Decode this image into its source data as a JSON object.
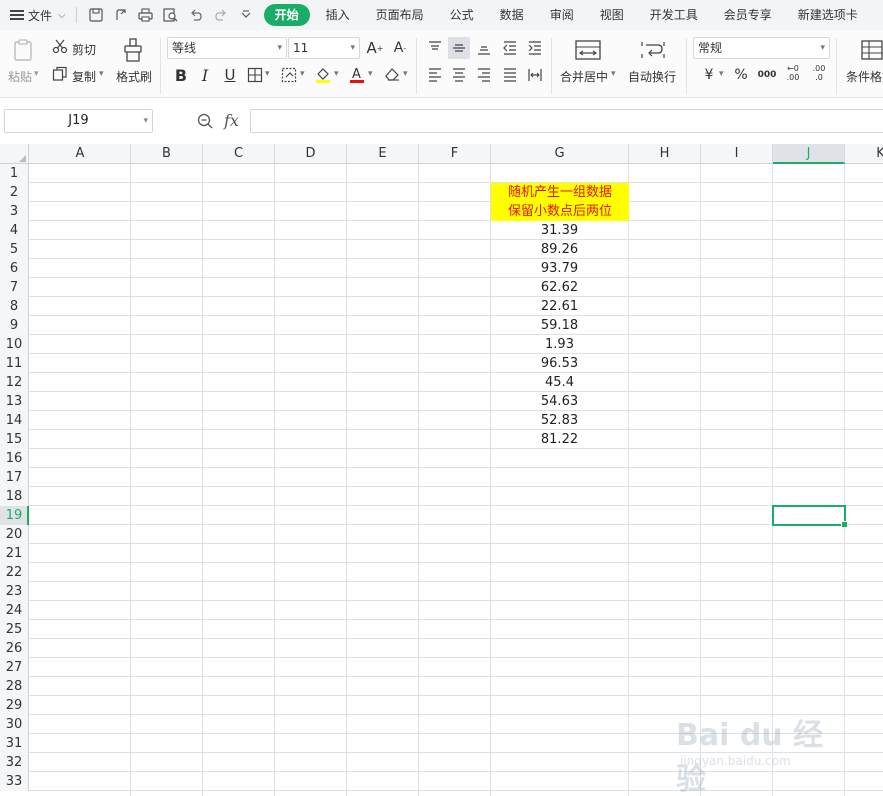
{
  "menubar": {
    "file_label": "文件",
    "tabs": [
      "开始",
      "插入",
      "页面布局",
      "公式",
      "数据",
      "审阅",
      "视图",
      "开发工具",
      "会员专享",
      "新建选项卡"
    ],
    "active_tab": "开始"
  },
  "ribbon": {
    "paste": "粘贴",
    "cut": "剪切",
    "copy": "复制",
    "format_painter": "格式刷",
    "font_name": "等线",
    "font_size": "11",
    "bold": "B",
    "italic": "I",
    "underline": "U",
    "merge_center": "合并居中",
    "wrap_text": "自动换行",
    "number_format": "常规",
    "currency": "¥",
    "percent": "%",
    "thousands": "000",
    "inc_decimal": ".00",
    "dec_decimal": ".0",
    "conditional_format": "条件格式"
  },
  "formula_bar": {
    "name_box": "J19",
    "fx": "fx",
    "value": ""
  },
  "columns": [
    "A",
    "B",
    "C",
    "D",
    "E",
    "F",
    "G",
    "H",
    "I",
    "J",
    "K"
  ],
  "selected_column": "J",
  "selected_row": "19",
  "rows": [
    "1",
    "2",
    "3",
    "4",
    "5",
    "6",
    "7",
    "8",
    "9",
    "10",
    "11",
    "12",
    "13",
    "14",
    "15",
    "16",
    "17",
    "18",
    "19",
    "20",
    "21",
    "22",
    "23",
    "24",
    "25",
    "26",
    "27",
    "28",
    "29",
    "30",
    "31",
    "32",
    "33"
  ],
  "cells": {
    "G2": "随机产生一组数据",
    "G3": "保留小数点后两位",
    "G_values": [
      "31.39",
      "89.26",
      "93.79",
      "62.62",
      "22.61",
      "59.18",
      "1.93",
      "96.53",
      "45.4",
      "54.63",
      "52.83",
      "81.22"
    ]
  },
  "colors": {
    "accent": "#1aad67",
    "header_fill": "#ffff00",
    "header_text": "#e8120c"
  },
  "watermark": {
    "title": "Bai du 经验",
    "subtitle": "jingyan.baidu.com"
  }
}
